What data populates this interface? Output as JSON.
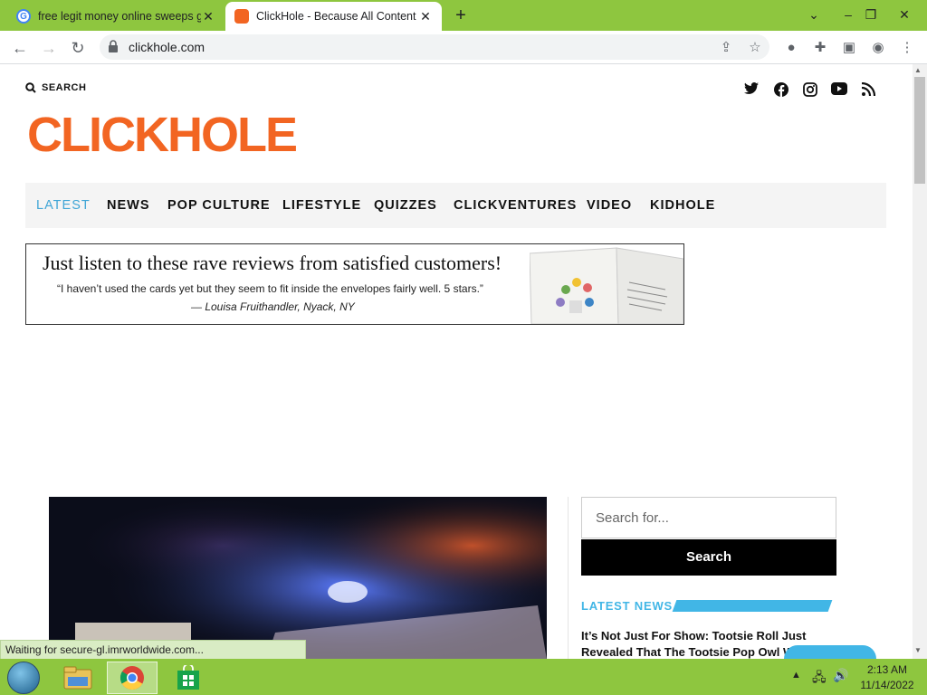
{
  "browser": {
    "tabs": [
      {
        "title": "free legit money online sweeps g",
        "active": false
      },
      {
        "title": "ClickHole - Because All Content I",
        "active": true
      }
    ],
    "new_tab_label": "+",
    "window_controls": {
      "minimize": "–",
      "restore": "❐",
      "close": "✕",
      "tab_list": "⌄"
    },
    "url": "clickhole.com"
  },
  "site": {
    "search_label": "SEARCH",
    "logo_text": "CLICKHOLE",
    "social_icons": [
      "twitter-icon",
      "facebook-icon",
      "instagram-icon",
      "youtube-icon",
      "rss-icon"
    ],
    "nav": [
      "LATEST",
      "NEWS",
      "POP CULTURE",
      "LIFESTYLE",
      "QUIZZES",
      "CLICKVENTURES",
      "VIDEO",
      "KIDHOLE"
    ],
    "nav_active": "LATEST",
    "ad": {
      "headline": "Just listen to these rave reviews from satisfied customers!",
      "quote": "“I haven’t used the cards yet but they seem to fit inside  the envelopes fairly well. 5 stars.”",
      "attribution": "— Louisa Fruithandler, Nyack, NY"
    },
    "sidebar": {
      "search_placeholder": "Search for...",
      "search_button": "Search",
      "latest_news_label": "LATEST NEWS",
      "headline": "It’s Not Just For Show: Tootsie Roll Just Revealed That The Tootsie Pop Owl W"
    }
  },
  "status_bar_text": "Waiting for secure-gl.imrworldwide.com...",
  "taskbar": {
    "apps": [
      "file-explorer-icon",
      "chrome-icon",
      "store-icon"
    ],
    "time": "2:13 AM",
    "date": "11/14/2022"
  },
  "colors": {
    "accent_orange": "#f26522",
    "accent_blue": "#41b6e6",
    "taskbar_green": "#8ec63f"
  }
}
